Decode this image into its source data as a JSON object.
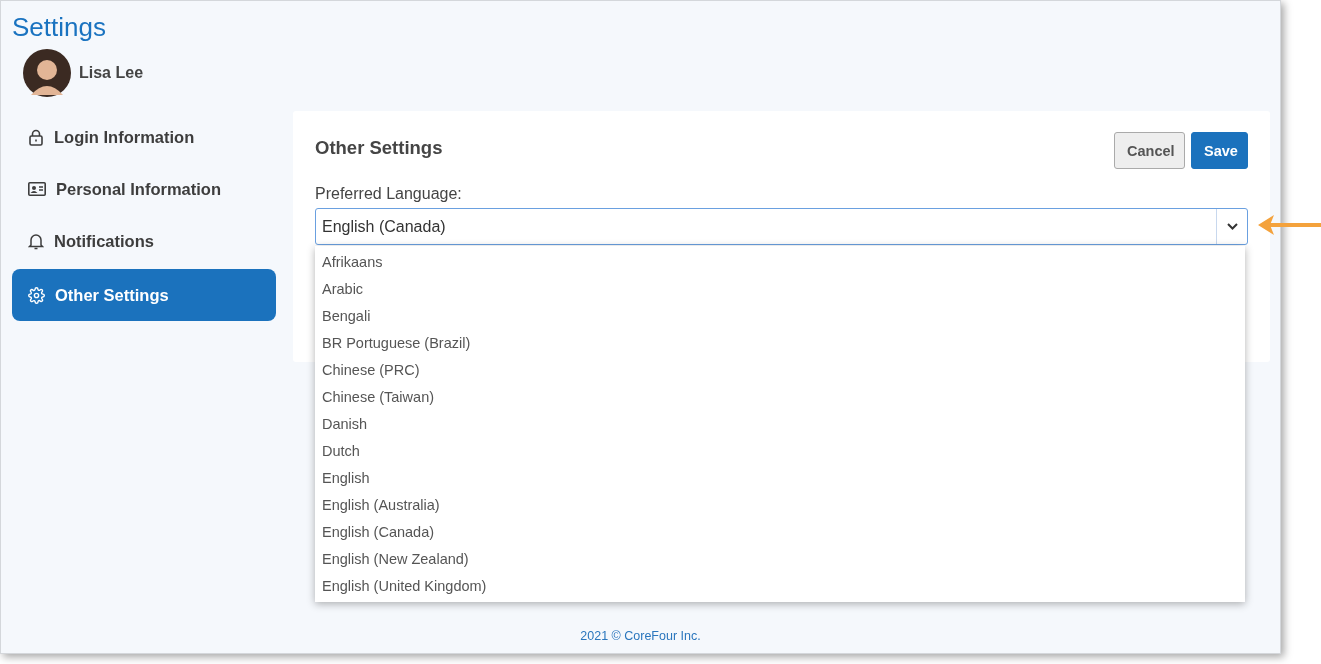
{
  "page": {
    "title": "Settings"
  },
  "user": {
    "name": "Lisa Lee"
  },
  "sidebar": {
    "items": [
      {
        "label": "Login Information",
        "kind": "login",
        "selected": false
      },
      {
        "label": "Personal Information",
        "kind": "personal",
        "selected": false
      },
      {
        "label": "Notifications",
        "kind": "notifications",
        "selected": false
      },
      {
        "label": "Other Settings",
        "kind": "other",
        "selected": true
      }
    ]
  },
  "panel": {
    "title": "Other Settings",
    "buttons": [
      {
        "label": "Cancel",
        "kind": "secondary"
      },
      {
        "label": "Save",
        "kind": "primary"
      }
    ],
    "field": {
      "label": "Preferred Language:",
      "value": "English (Canada)",
      "expanded": true,
      "options": [
        "Afrikaans",
        "Arabic",
        "Bengali",
        "BR Portuguese (Brazil)",
        "Chinese (PRC)",
        "Chinese (Taiwan)",
        "Danish",
        "Dutch",
        "English",
        "English (Australia)",
        "English (Canada)",
        "English (New Zealand)",
        "English (United Kingdom)"
      ]
    }
  },
  "footer": {
    "copyright": "2021 © CoreFour Inc."
  }
}
